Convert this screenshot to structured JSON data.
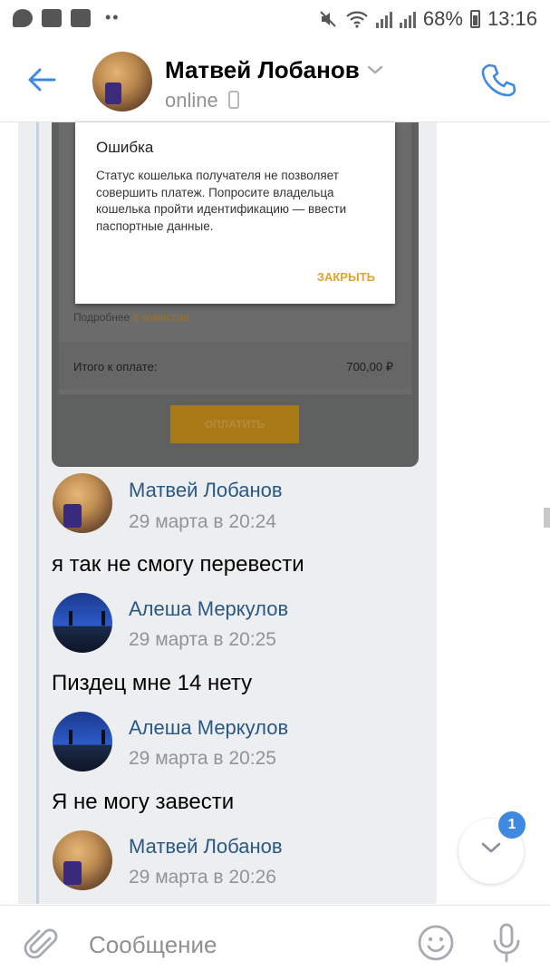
{
  "status_bar": {
    "battery": "68%",
    "time": "13:16",
    "icons": [
      "message-icon",
      "image-icon",
      "youtube-icon",
      "more-dots-icon",
      "mute-icon",
      "wifi-icon",
      "signal-icon",
      "battery-icon"
    ]
  },
  "header": {
    "name": "Матвей Лобанов",
    "status": "online",
    "icons": [
      "back-arrow-icon",
      "chevron-down-icon",
      "phone-icon",
      "mobile-icon"
    ],
    "accent": "#3f8ae0"
  },
  "screenshot": {
    "dialog_title": "Ошибка",
    "dialog_body": "Статус кошелька получателя не позволяет совершить платеж. Попросите владельца кошелька пройти идентификацию — ввести паспортные данные.",
    "dialog_close": "ЗАКРЫТЬ",
    "commission_prefix": "Подробнее",
    "commission_link": "о комиссии",
    "total_label": "Итого к оплате:",
    "total_value": "700,00 ₽",
    "pay_button": "ОПЛАТИТЬ"
  },
  "messages": [
    {
      "author": "Матвей Лобанов",
      "time": "29 марта в 20:24",
      "text": "я так не смогу перевести"
    },
    {
      "author": "Алеша Меркулов",
      "time": "29 марта в 20:25",
      "text": "Пиздец мне 14 нету"
    },
    {
      "author": "Алеша Меркулов",
      "time": "29 марта в 20:25",
      "text": "Я не могу завести"
    },
    {
      "author": "Матвей Лобанов",
      "time": "29 марта в 20:26",
      "text": ""
    }
  ],
  "scroll_down": {
    "badge": "1"
  },
  "composer": {
    "placeholder": "Сообщение",
    "icons": [
      "paperclip-icon",
      "smile-icon",
      "microphone-icon"
    ]
  }
}
